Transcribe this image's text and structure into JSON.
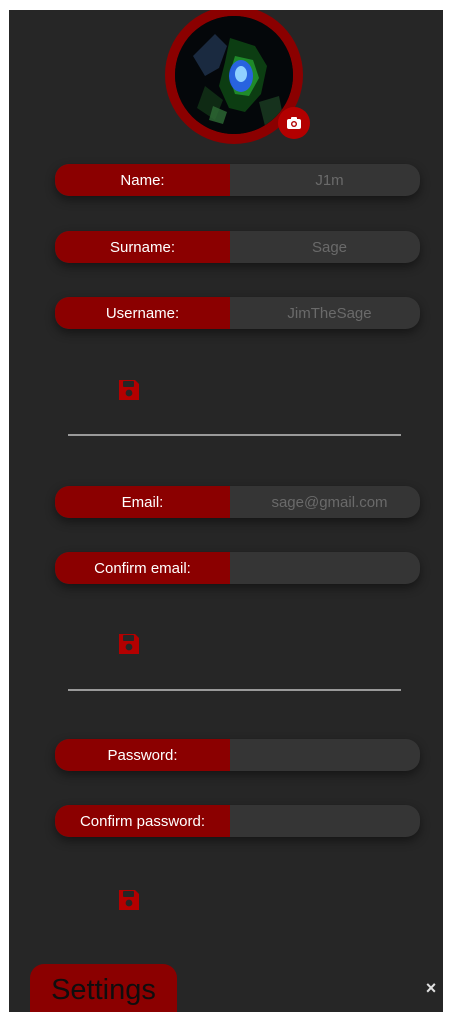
{
  "profile": {
    "camera_icon": "camera-icon"
  },
  "fields": [
    {
      "label": "Name:",
      "value": "J1m"
    },
    {
      "label": "Surname:",
      "value": "Sage"
    },
    {
      "label": "Username:",
      "value": "JimTheSage"
    },
    {
      "label": "Email:",
      "value": "sage@gmail.com"
    },
    {
      "label": "Confirm email:",
      "value": ""
    },
    {
      "label": "Password:",
      "value": ""
    },
    {
      "label": "Confirm password:",
      "value": ""
    }
  ],
  "icons": {
    "save": "floppy-disk-icon",
    "close": "close-icon"
  },
  "footer": {
    "settings_label": "Settings",
    "close_glyph": "×"
  },
  "colors": {
    "panel_bg": "#262626",
    "accent": "#8b0000",
    "field_bg": "#353535",
    "save_icon": "#b30000"
  }
}
